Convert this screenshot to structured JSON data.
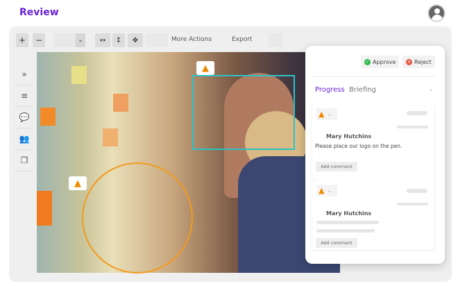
{
  "header": {
    "title": "Review",
    "avatar_icon": "user-icon"
  },
  "toolbar": {
    "zoom_in": "+",
    "zoom_out": "−",
    "fit_width": "↔",
    "fit_height": "↕",
    "fit_all": "✥",
    "more_actions": "More Actions",
    "export": "Export",
    "chevron": "⌄"
  },
  "sidebar": {
    "items": [
      "»",
      "≡",
      "💬",
      "👥",
      "❐"
    ]
  },
  "panel": {
    "approve": "Approve",
    "reject": "Reject",
    "tabs": {
      "progress": "Progress",
      "briefing": "Briefing"
    },
    "comments": [
      {
        "author": "Mary Hutchins",
        "text": "Please place our logo on the pen.",
        "add_label": "Add comment"
      },
      {
        "author": "Mary Hutchins",
        "text": "",
        "add_label": "Add comment"
      }
    ]
  },
  "colors": {
    "accent": "#6a22d6",
    "selection": "#2ac3c8",
    "annotation": "#f39a1d"
  }
}
